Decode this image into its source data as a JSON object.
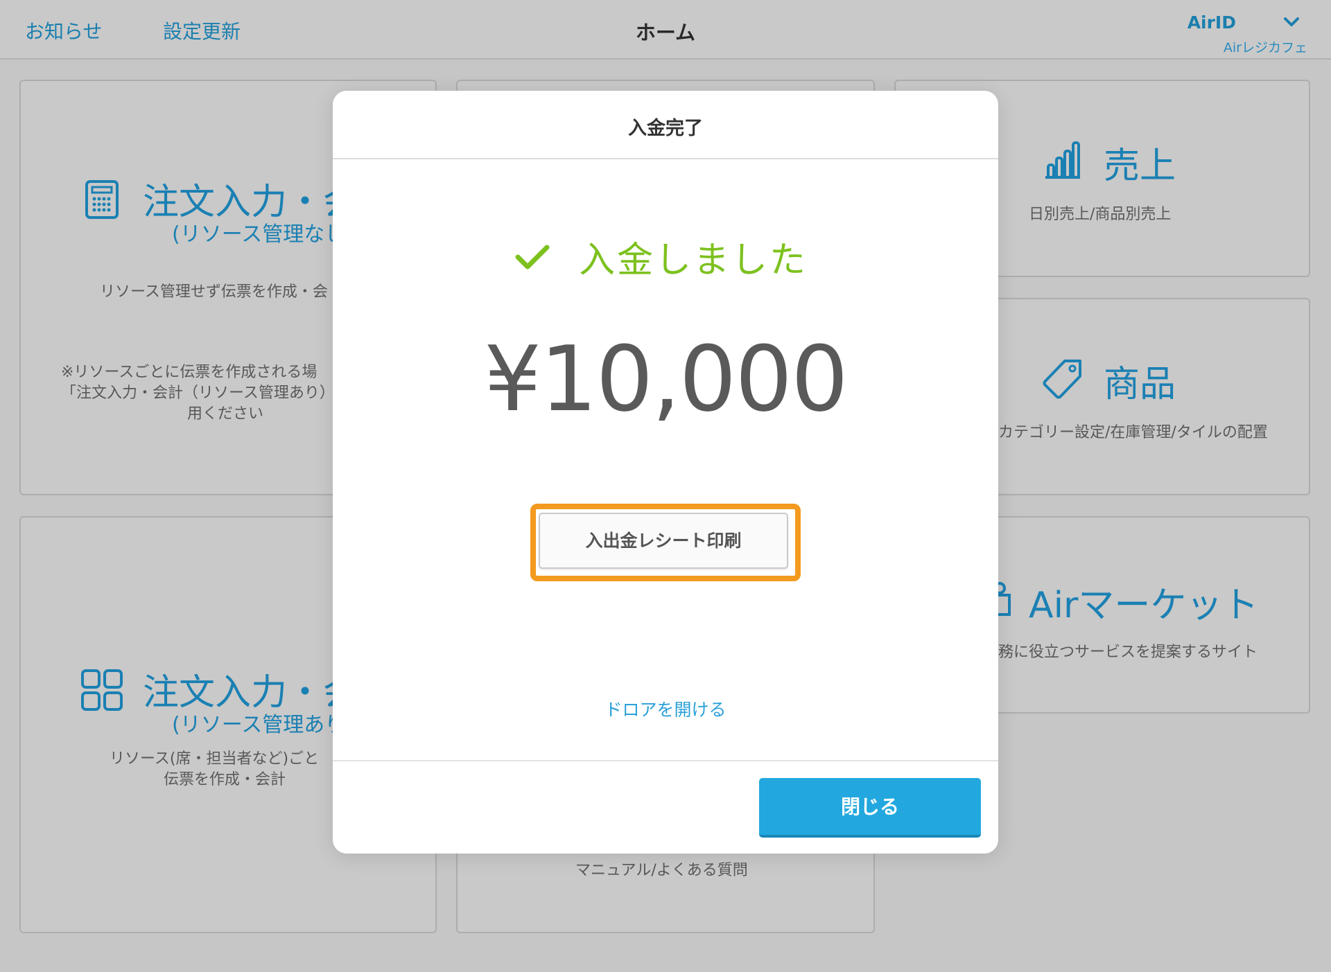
{
  "header": {
    "news_label": "お知らせ",
    "settings_update_label": "設定更新",
    "title": "ホーム",
    "airid_label": "AirID",
    "store_name": "Airレジカフェ"
  },
  "tiles": {
    "order_no_resource": {
      "title": "注文入力・会",
      "subtitle": "(リソース管理なし",
      "desc": "リソース管理せず伝票を作成・会",
      "note_line1": "※リソースごとに伝票を作成される場",
      "note_line2": "「注文入力・会計（リソース管理あり）",
      "note_line3": "用ください"
    },
    "sales": {
      "title": "売上",
      "desc": "日別売上/商品別売上"
    },
    "products": {
      "title": "商品",
      "desc": "カテゴリー設定/在庫管理/タイルの配置"
    },
    "order_with_resource": {
      "title": "注文入力・会",
      "subtitle": "(リソース管理あり",
      "desc_line1": "リソース(席・担当者など)ごと",
      "desc_line2": "伝票を作成・会計"
    },
    "air_market": {
      "title": "Airマーケット",
      "desc": "務に役立つサービスを提案するサイト"
    },
    "help": {
      "desc": "マニュアル/よくある質問"
    }
  },
  "modal": {
    "title": "入金完了",
    "success_message": "入金しました",
    "amount": "¥10,000",
    "receipt_button_label": "入出金レシート印刷",
    "open_drawer_label": "ドロアを開ける",
    "close_button_label": "閉じる"
  },
  "colors": {
    "accent_blue": "#22a8de",
    "success_green": "#7dc11f",
    "highlight_orange": "#f39a1f"
  }
}
